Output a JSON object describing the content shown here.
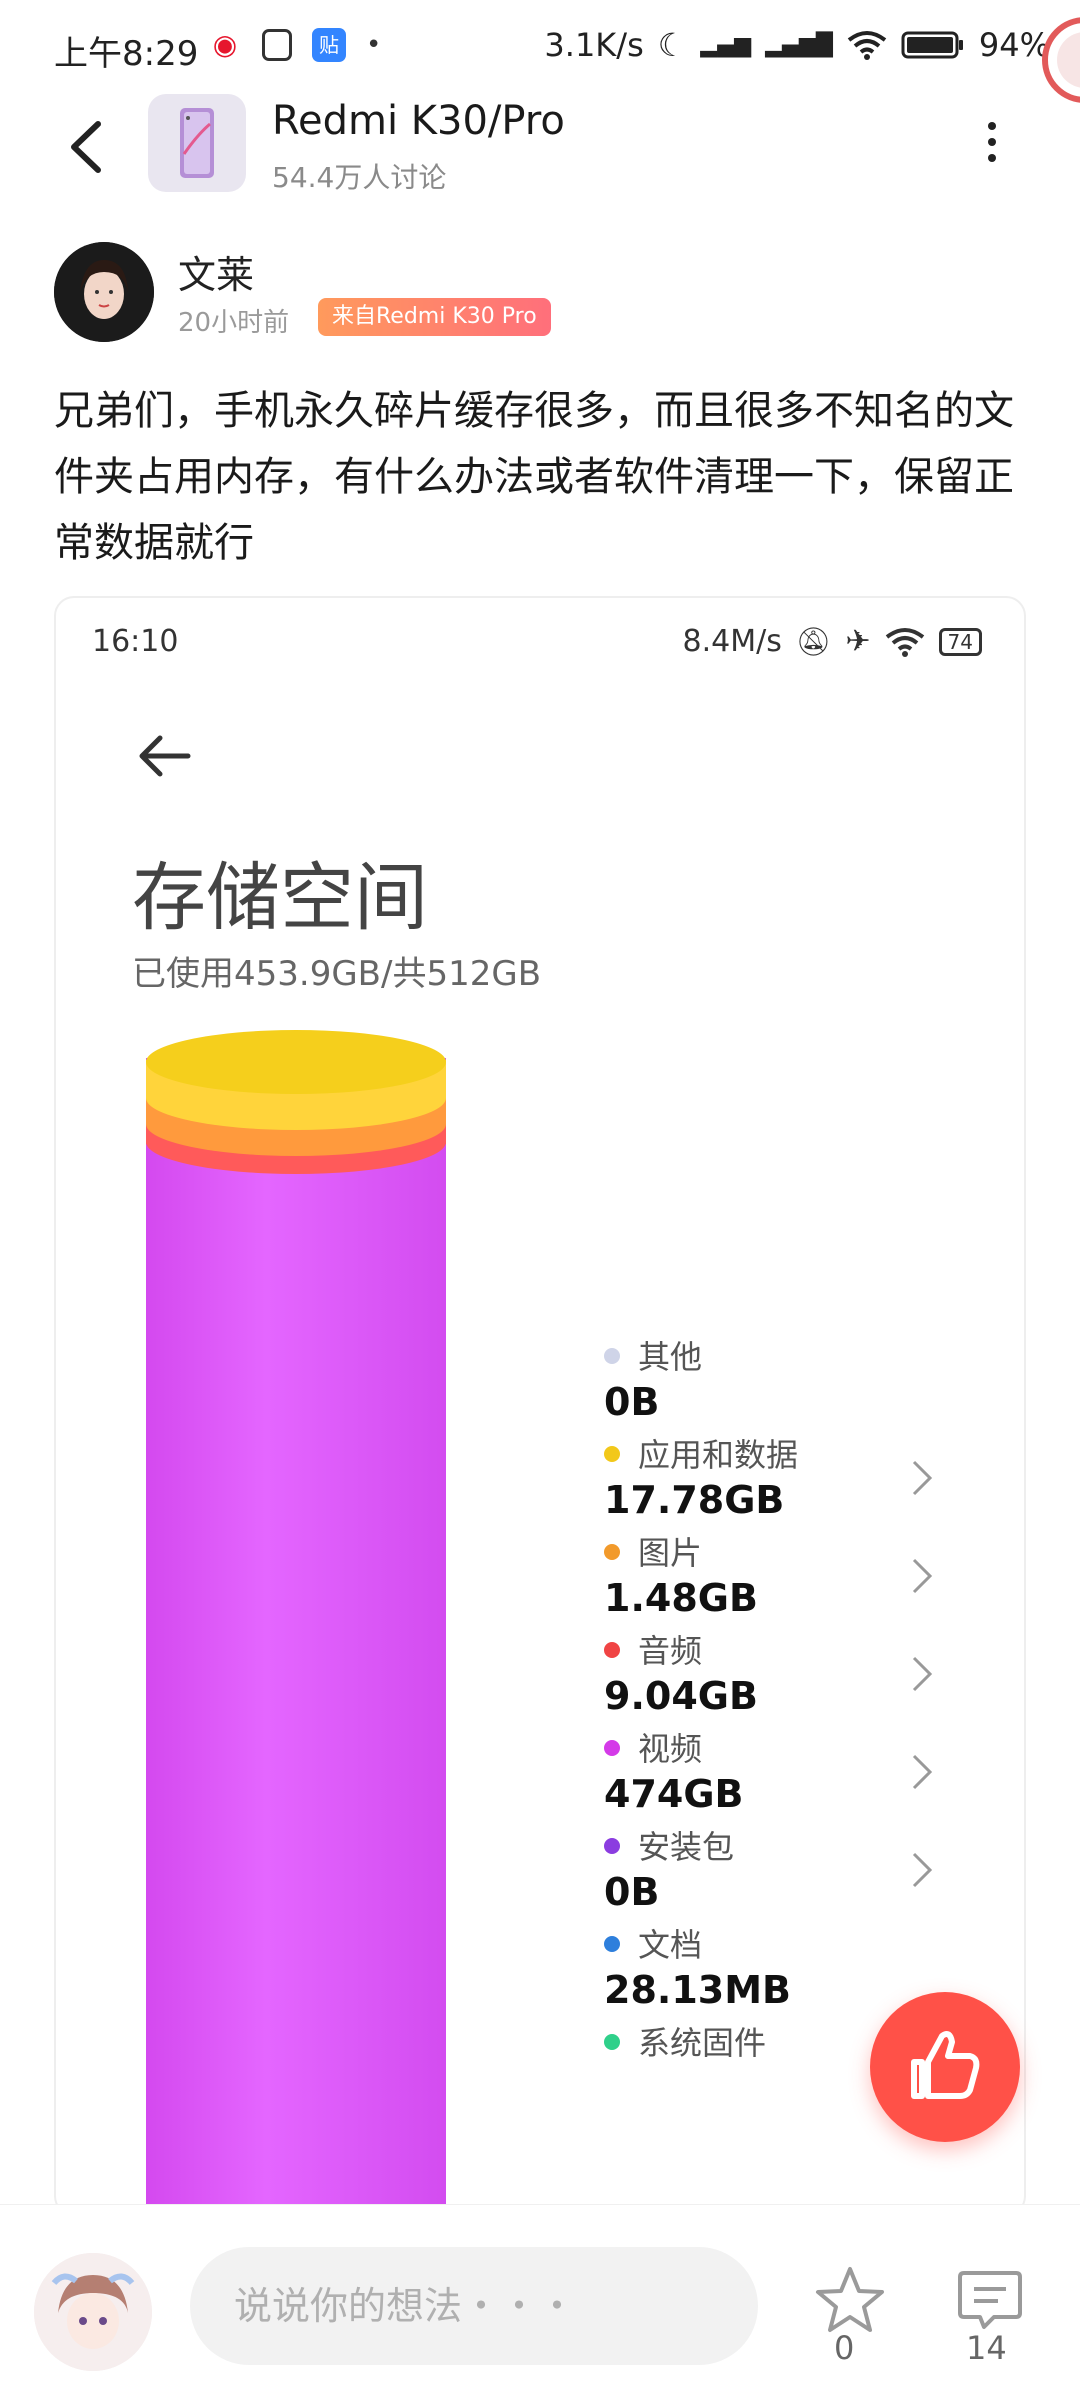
{
  "status_bar": {
    "time": "上午8:29",
    "network_speed": "3.1K/s",
    "battery": "94%"
  },
  "header": {
    "forum_title": "Redmi K30/Pro",
    "forum_subtitle": "54.4万人讨论"
  },
  "post": {
    "author": "文莱",
    "time": "20小时前",
    "device_tag": "来自Redmi K30 Pro",
    "text": "兄弟们，手机永久碎片缓存很多，而且很多不知名的文件夹占用内存，有什么办法或者软件清理一下，保留正常数据就行"
  },
  "embedded_screenshot": {
    "time": "16:10",
    "network_speed": "8.4M/s",
    "battery": "74",
    "title": "存储空间",
    "used": "已使用453.9GB/共512GB",
    "legend": [
      {
        "label": "其他",
        "value": "0B",
        "color": "#cfd4e8"
      },
      {
        "label": "应用和数据",
        "value": "17.78GB",
        "color": "#f2c81a"
      },
      {
        "label": "图片",
        "value": "1.48GB",
        "color": "#f29a2b"
      },
      {
        "label": "音频",
        "value": "9.04GB",
        "color": "#f04444"
      },
      {
        "label": "视频",
        "value": "474GB",
        "color": "#d43ae8"
      },
      {
        "label": "安装包",
        "value": "0B",
        "color": "#8b3de0"
      },
      {
        "label": "文档",
        "value": "28.13MB",
        "color": "#2e7fdc"
      },
      {
        "label": "系统固件",
        "value": "",
        "color": "#2fd08a"
      }
    ]
  },
  "bottom_bar": {
    "comment_placeholder": "说说你的想法・・・",
    "star_count": "0",
    "comment_count": "14"
  },
  "colors": {
    "fab": "#ff5148",
    "device_tag_start": "#ff9a5c",
    "device_tag_end": "#ff6f7b"
  }
}
